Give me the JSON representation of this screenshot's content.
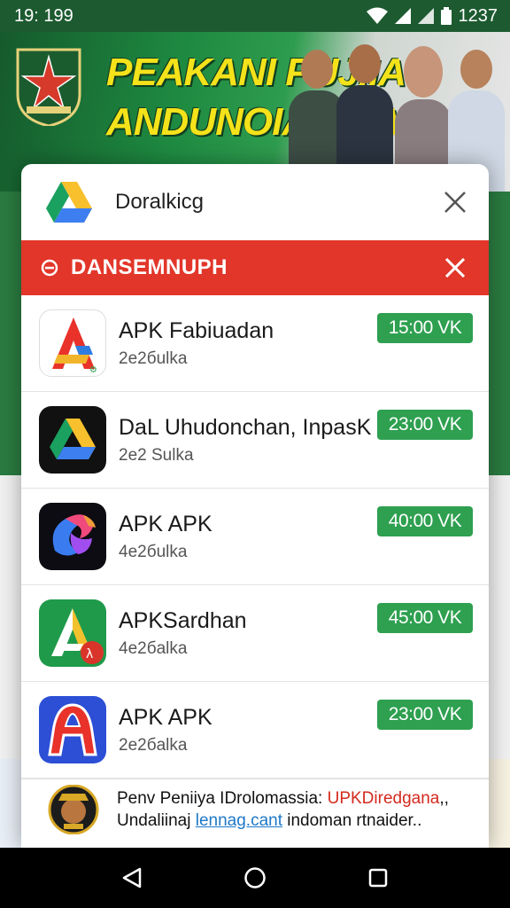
{
  "status_bar": {
    "time": "19: 199",
    "battery_text": "1237"
  },
  "banner": {
    "title_line1": "PEAKANI PUJIIA",
    "title_line2": "ANDUNOIARDIA",
    "accent_color": "#f4e21a"
  },
  "dialog": {
    "title": "Doralkicg",
    "logo_icon": "drive-logo-icon",
    "close_icon": "close-icon"
  },
  "alert": {
    "label": "DANSEMNUPH",
    "color": "#e2362a",
    "icon": "minus-circle-icon"
  },
  "apps": [
    {
      "name": "APK Fabiuadan",
      "size": "2e2бulka",
      "price": "15:00 VK",
      "icon": "apk-a-icon"
    },
    {
      "name": "DaL Uhudonchan, InpasK",
      "size": "2e2 Sulka",
      "price": "23:00 VK",
      "icon": "drive-dark-icon"
    },
    {
      "name": "APK APK",
      "size": "4e2бulka",
      "price": "40:00 VK",
      "icon": "swirl-icon"
    },
    {
      "name": "APKSardhan",
      "size": "4e2бalka",
      "price": "45:00 VK",
      "icon": "green-a-icon"
    },
    {
      "name": "APK APK",
      "size": "2e2бalka",
      "price": "23:00 VK",
      "icon": "blue-a-icon"
    }
  ],
  "price_color": "#2ea050",
  "footer": {
    "line1_text": "Penv Peniiya IDrolomassia: ",
    "line1_accent": "UPKDiredgana",
    "line1_tail": ",,",
    "line2_text": "Undaliinaj ",
    "line2_link": "lennag.cant",
    "line2_tail": " indoman rtnaider..",
    "emblem_icon": "emblem-icon"
  },
  "nav": {
    "back": "back-icon",
    "home": "home-icon",
    "recents": "recents-icon"
  }
}
